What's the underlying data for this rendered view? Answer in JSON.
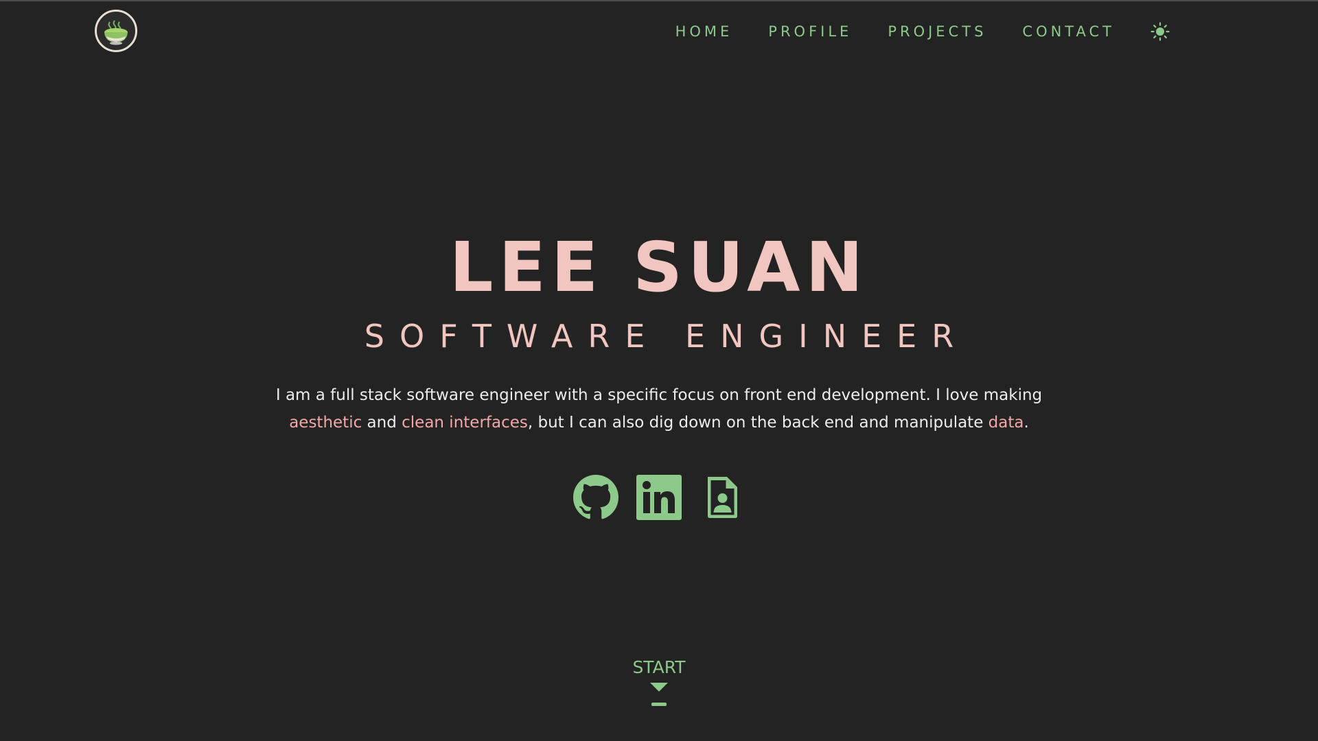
{
  "nav": {
    "logo_alt": "ramen bowl logo",
    "links": [
      {
        "label": "HOME"
      },
      {
        "label": "PROFILE"
      },
      {
        "label": "PROJECTS"
      },
      {
        "label": "CONTACT"
      }
    ],
    "theme_icon": "sun-icon"
  },
  "hero": {
    "name": "LEE SUAN",
    "title": "SOFTWARE ENGINEER",
    "desc": {
      "part1": "I am a full stack software engineer with a specific focus on front end development. I love making ",
      "hl1": "aesthetic",
      "part2": " and ",
      "hl2": "clean interfaces",
      "part3": ", but I can also dig down on the back end and manipulate ",
      "hl3": "data",
      "part4": "."
    }
  },
  "socials": [
    {
      "icon": "github-icon"
    },
    {
      "icon": "linkedin-icon"
    },
    {
      "icon": "resume-icon"
    }
  ],
  "start": {
    "label": "START",
    "icon": "chevron-down-icon"
  },
  "colors": {
    "background": "#232323",
    "accent_green": "#8cc98a",
    "accent_pink": "#f1c6c0",
    "highlight_pink": "#f4a7a7",
    "text": "#ececec"
  }
}
